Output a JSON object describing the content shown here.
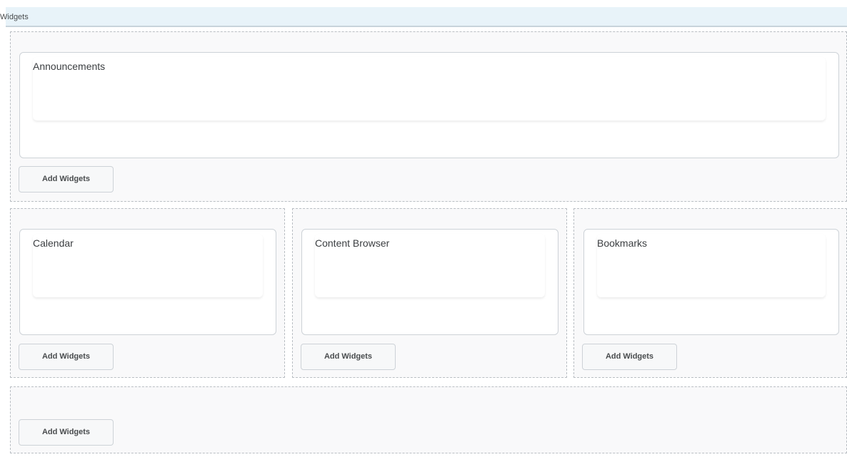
{
  "header": {
    "title": "Widgets"
  },
  "zones": {
    "top": {
      "widget_title": "Announcements",
      "add_label": "Add Widgets"
    },
    "left": {
      "widget_title": "Calendar",
      "add_label": "Add Widgets"
    },
    "middle": {
      "widget_title": "Content Browser",
      "add_label": "Add Widgets"
    },
    "right": {
      "widget_title": "Bookmarks",
      "add_label": "Add Widgets"
    },
    "bottom": {
      "add_label": "Add Widgets"
    }
  },
  "colors": {
    "header_bg": "#e8f3f9",
    "zone_bg": "#f9f9fa",
    "border": "#cdd2d7"
  }
}
